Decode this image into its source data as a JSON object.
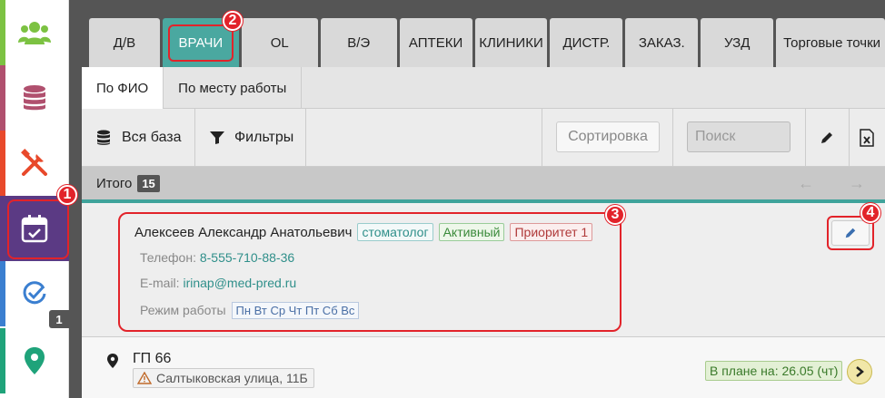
{
  "tabs": [
    {
      "label": "Д/В"
    },
    {
      "label": "ВРАЧИ"
    },
    {
      "label": "OL"
    },
    {
      "label": "В/Э"
    },
    {
      "label": "АПТЕКИ"
    },
    {
      "label": "КЛИНИКИ"
    },
    {
      "label": "ДИСТР."
    },
    {
      "label": "ЗАКАЗ."
    },
    {
      "label": "УЗД"
    },
    {
      "label": "Торговые точки"
    }
  ],
  "subtabs": [
    {
      "label": "По ФИО"
    },
    {
      "label": "По месту работы"
    }
  ],
  "toolbar": {
    "all_base_label": "Вся база",
    "filters_label": "Фильтры",
    "sort_label": "Сортировка",
    "search_placeholder": "Поиск"
  },
  "totals": {
    "label": "Итого",
    "count": "15"
  },
  "doctor": {
    "name": "Алексеев Александр Анатольевич",
    "specialty": "стоматолог",
    "status": "Активный",
    "priority": "Приоритет 1",
    "phone_label": "Телефон:",
    "phone": "8-555-710-88-36",
    "email_label": "E-mail:",
    "email": "irinap@med-pred.ru",
    "schedule_label": "Режим работы",
    "schedule": "Пн Вт Ср Чт Пт Сб Вс"
  },
  "place": {
    "name": "ГП 66",
    "address": "Салтыковская улица, 11Б",
    "plan": "В плане на: 26.05 (чт)"
  },
  "sidebar_badge": "1",
  "markers": [
    "1",
    "2",
    "3",
    "4"
  ],
  "colors": {
    "accent": "#4aa8a0",
    "active_sidebar": "#5b3a84",
    "marker": "#e2232a"
  }
}
